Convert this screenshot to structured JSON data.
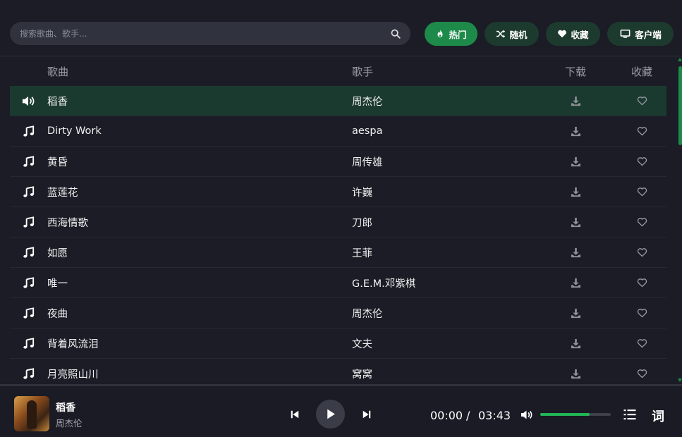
{
  "search": {
    "placeholder": "搜索歌曲、歌手..."
  },
  "nav": {
    "hot": "热门",
    "random": "随机",
    "favorites": "收藏",
    "client": "客户端"
  },
  "table": {
    "headers": {
      "song": "歌曲",
      "artist": "歌手",
      "download": "下载",
      "favorite": "收藏"
    },
    "rows": [
      {
        "song": "稻香",
        "artist": "周杰伦",
        "playing": true
      },
      {
        "song": "Dirty Work",
        "artist": "aespa",
        "playing": false
      },
      {
        "song": "黄昏",
        "artist": "周传雄",
        "playing": false
      },
      {
        "song": "蓝莲花",
        "artist": "许巍",
        "playing": false
      },
      {
        "song": "西海情歌",
        "artist": "刀郎",
        "playing": false
      },
      {
        "song": "如愿",
        "artist": "王菲",
        "playing": false
      },
      {
        "song": "唯一",
        "artist": "G.E.M.邓紫棋",
        "playing": false
      },
      {
        "song": "夜曲",
        "artist": "周杰伦",
        "playing": false
      },
      {
        "song": "背着风流泪",
        "artist": "文夫",
        "playing": false
      },
      {
        "song": "月亮照山川",
        "artist": "窝窝",
        "playing": false
      }
    ]
  },
  "player": {
    "title": "稻香",
    "artist": "周杰伦",
    "current_time": "00:00",
    "separator": "/",
    "duration": "03:43",
    "volume_fraction": 0.7,
    "lyrics_label": "词"
  },
  "colors": {
    "accent": "#1e8a4a",
    "nav_button": "#1d3a2e",
    "playing_row": "#1b3a2f",
    "volume_fill": "#22b556"
  },
  "icons": {
    "search": "search-icon",
    "hot": "fire-icon",
    "random": "shuffle-icon",
    "favorites": "heart-icon",
    "client": "monitor-icon",
    "playing": "speaker-icon",
    "row": "music-note-icon",
    "download": "download-icon",
    "favorite": "heart-outline-icon"
  }
}
